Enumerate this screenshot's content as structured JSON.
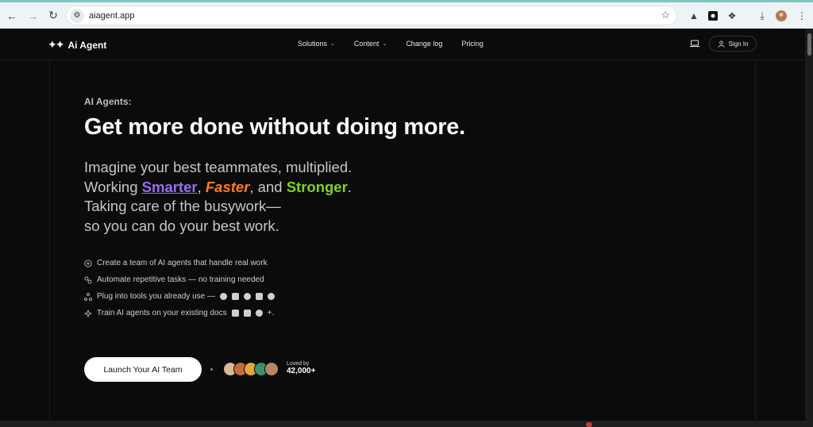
{
  "browser": {
    "url": "aiagent.app"
  },
  "header": {
    "brand": "Ai Agent",
    "menu": [
      {
        "label": "Solutions",
        "has_dropdown": true
      },
      {
        "label": "Content",
        "has_dropdown": true
      },
      {
        "label": "Change log",
        "has_dropdown": false
      },
      {
        "label": "Pricing",
        "has_dropdown": false
      }
    ],
    "sign_in": "Sign In"
  },
  "hero": {
    "eyebrow": "AI Agents:",
    "headline": "Get more done without doing more.",
    "line1": "Imagine your best teammates, multiplied.",
    "line2_prefix": "Working ",
    "smarter": "Smarter",
    "comma1": ", ",
    "faster": "Faster",
    "and": ", and ",
    "stronger": "Stronger",
    "period": ".",
    "line3": "Taking care of the busywork—",
    "line4": "so you can do your best work."
  },
  "features": [
    {
      "icon": "plus-circle-icon",
      "text": "Create a team of AI agents that handle real work"
    },
    {
      "icon": "link-icon",
      "text": "Automate repetitive tasks — no training needed"
    },
    {
      "icon": "nodes-icon",
      "text": "Plug into tools you already use —"
    },
    {
      "icon": "sparkle-icon",
      "text": "Train AI agents on your existing docs"
    }
  ],
  "docs_suffix": "+.",
  "cta": {
    "label": "Launch Your AI Team",
    "loved_label": "Loved by",
    "loved_count": "42,000+"
  },
  "colors": {
    "smarter": "#9a6cf0",
    "faster": "#ff7a1f",
    "stronger": "#7ed321"
  }
}
